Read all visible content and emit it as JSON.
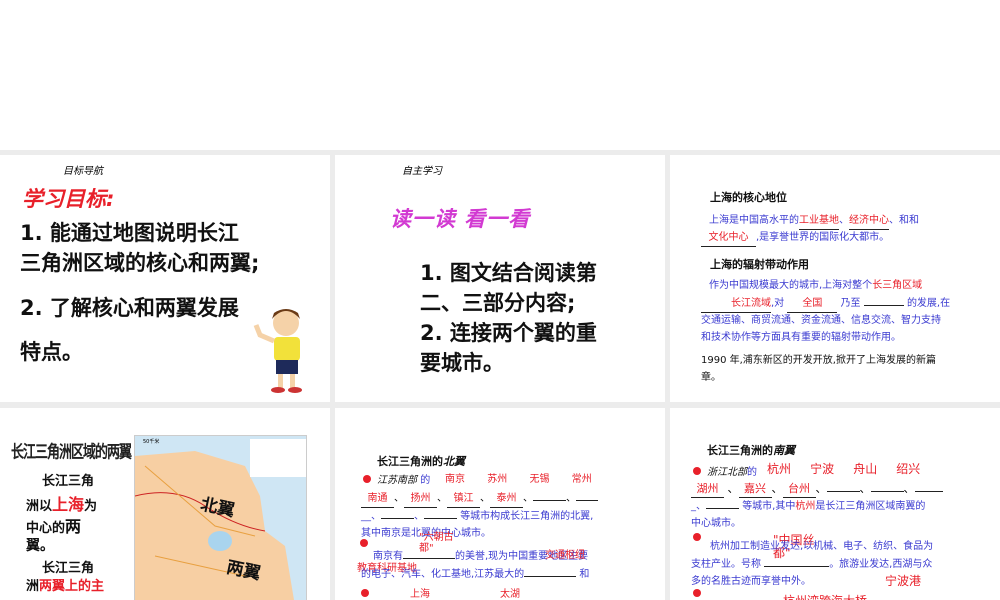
{
  "slides": [
    {
      "nav": "目标导航",
      "heading": "学习目标:",
      "l1": "1. 能通过地图说明长江",
      "l2": "三角洲区域的核心和两翼;",
      "l3": "2. 了解核心和两翼发展",
      "l4": "特点。"
    },
    {
      "nav": "自主学习",
      "art": "读一读 看一看",
      "l1": "1. 图文结合阅读第",
      "l2": "二、三部分内容;",
      "l3": "2. 连接两个翼的重",
      "l4": "要城市。"
    },
    {
      "h1": "上海的核心地位",
      "p1a": "上海是中国高水平的",
      "a1": "工业基地",
      "a2": "经济中心",
      "p1b": "、和和",
      "a3": "文化中心",
      "p1c": ",是享誉世界的国际化大都市。",
      "h2": "上海的辐射带动作用",
      "p2a": "作为中国规模最大的城市,上海对整个",
      "a4": "长三角区域",
      "a5": "长江流域",
      "p2b": ",对",
      "a6": "全国",
      "p2c": "乃至",
      "p2d": "的发展,在",
      "p2e": "交通运输、商贸流通、资金流通、信息交流、智力支持",
      "p2f": "和技术协作等方面具有重要的辐射带动作用。",
      "p3": "1990 年,浦东新区的开发开放,掀开了上海发展的新篇",
      "p3b": "章。"
    },
    {
      "title": "长江三角洲区域的两翼",
      "t1": "长江三角",
      "t2a": "洲以",
      "t2b": "上海",
      "t2c": "为",
      "t3a": "中心的",
      "t3b": "两",
      "t4": "翼。",
      "t5": "长江三角",
      "t6a": "洲",
      "t6b": "两翼上的主",
      "map_north": "北翼",
      "map_south": "两翼",
      "map_scale": "50千米"
    },
    {
      "title_a": "长江三角洲的",
      "title_b": "北翼",
      "b1": "江苏南部",
      "b1b": "的",
      "cities": [
        "南京",
        "苏州",
        "无锡",
        "常州",
        "南通",
        "扬州",
        "镇江",
        "泰州"
      ],
      "line3": "等城市构成长江三角洲的北翼,",
      "line4": "其中南京是北翼的中心城市。",
      "ov1": "\"六朝古都\"",
      "line5a": "南京有",
      "line5b": "的美誉,现为中国重要地区主要",
      "ov2": "交通枢纽",
      "ov3": "教育科研基地",
      "line6": "的电子、汽车、化工基地,江苏最大的",
      "line6b": "和",
      "last1": "上海",
      "last2": "太湖"
    },
    {
      "title_a": "长江三角洲的",
      "title_b": "南翼",
      "b1": "浙江北部",
      "b1b": "的",
      "cities": [
        "杭州",
        "宁波",
        "舟山",
        "绍兴",
        "湖州",
        "嘉兴",
        "台州"
      ],
      "line3a": "等城市,其中",
      "line3b": "杭州",
      "line3c": "是长江三角洲区域南翼的",
      "line4": "中心城市。",
      "ov1": "\"中国丝都\"",
      "line5": "杭州加工制造业发达,以机械、电子、纺织、食品为",
      "line6a": "支柱产业。号称",
      "line6b": "。旅游业发达,西湖与众",
      "line7": "多的名胜古迹而享誉中外。",
      "ov2": "宁波港",
      "ov3": "杭州湾跨海大桥"
    }
  ]
}
